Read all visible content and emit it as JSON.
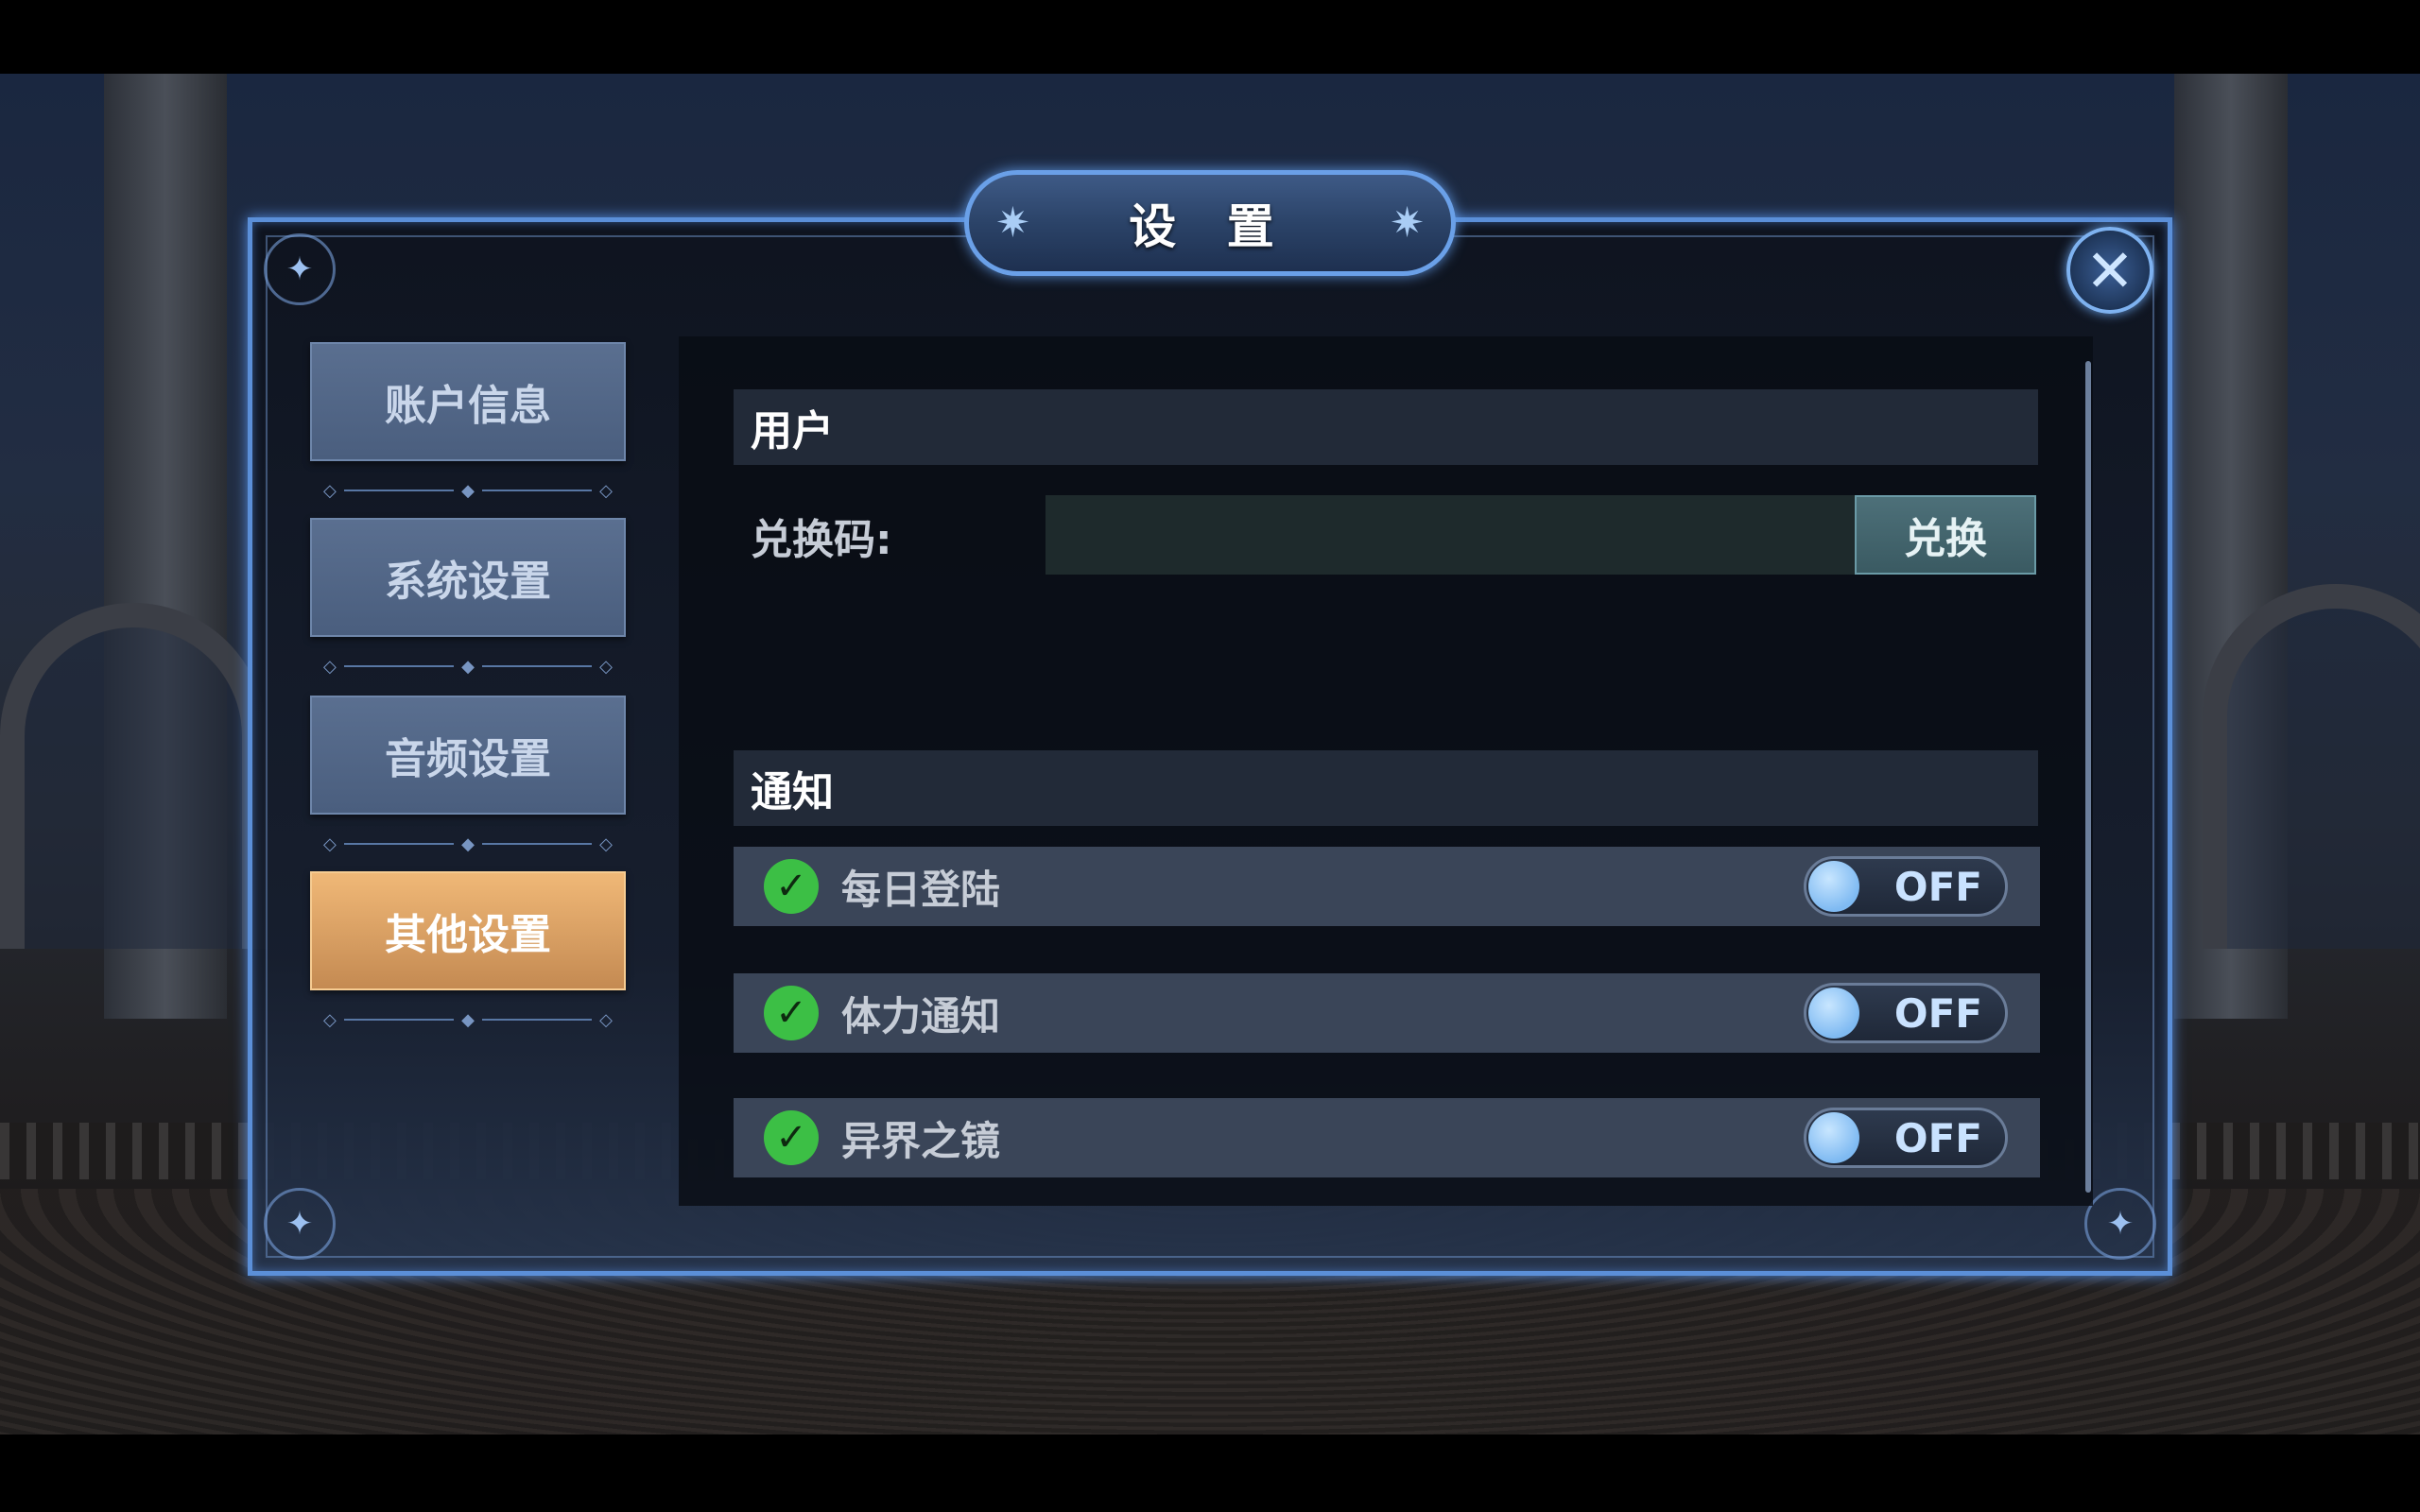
{
  "dialog": {
    "title": "设 置",
    "accent_color": "#5b8fd8"
  },
  "sidebar": {
    "items": [
      {
        "label": "账户信息",
        "active": false
      },
      {
        "label": "系统设置",
        "active": false
      },
      {
        "label": "音频设置",
        "active": false
      },
      {
        "label": "其他设置",
        "active": true
      }
    ],
    "active_color": "#e0a56a"
  },
  "user_section": {
    "header": "用户",
    "redeem_label": "兑换码:",
    "redeem_value": "",
    "redeem_button": "兑换"
  },
  "notification_section": {
    "header": "通知",
    "items": [
      {
        "label": "每日登陆",
        "checked": true,
        "state": "OFF"
      },
      {
        "label": "体力通知",
        "checked": true,
        "state": "OFF"
      },
      {
        "label": "异界之镜",
        "checked": true,
        "state": "OFF"
      }
    ]
  },
  "icons": {
    "close": "close-icon",
    "check": "check-icon",
    "title_ornament": "star-ornament-icon"
  }
}
